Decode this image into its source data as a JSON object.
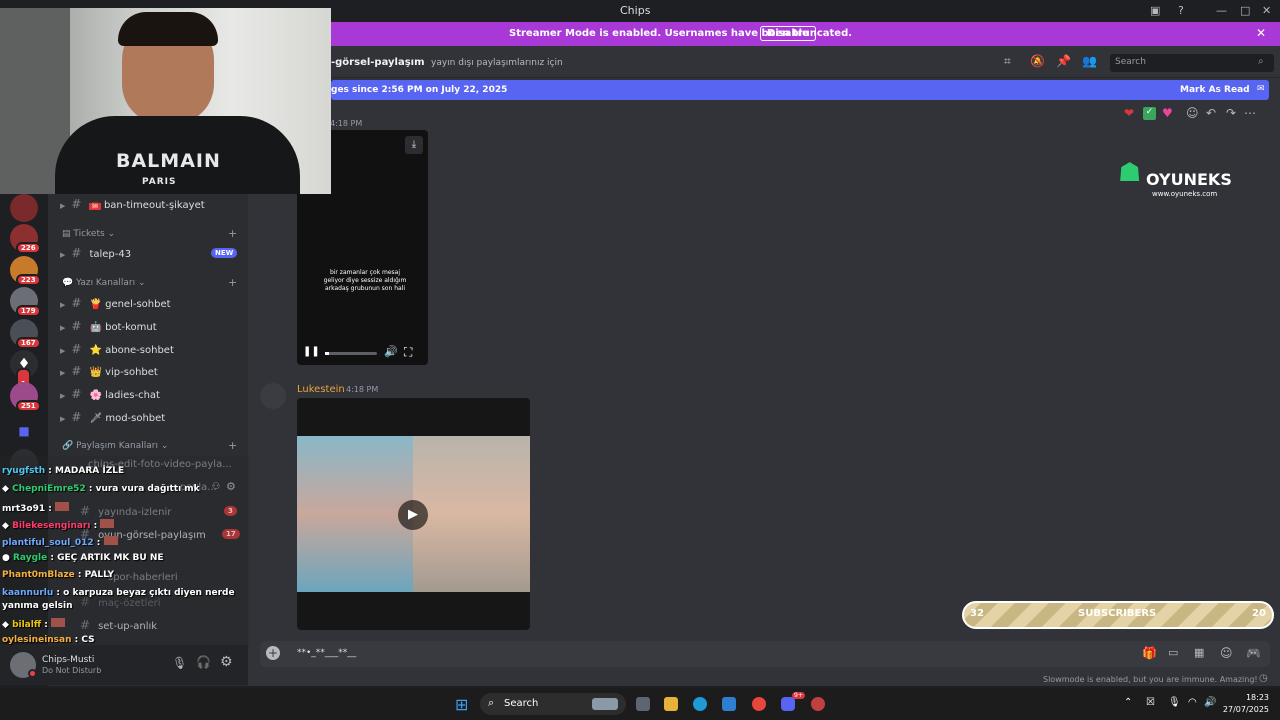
{
  "window": {
    "title": "Chips"
  },
  "banner": {
    "message": "Streamer Mode is enabled. Usernames have been truncated.",
    "disable_label": "Disable"
  },
  "header": {
    "channel": "-görsel-paylaşım",
    "topic": "yayın dışı paylaşımlarınız için",
    "search_placeholder": "Search"
  },
  "new_messages": {
    "text": "ges since 2:56 PM on July 22, 2025",
    "mark_read": "Mark As Read"
  },
  "servers": [
    {
      "count": "226"
    },
    {
      "count": "223"
    },
    {
      "count": "179"
    },
    {
      "count": "167"
    },
    {
      "count": "1"
    },
    {
      "count": "251"
    }
  ],
  "channels": {
    "ban_timeout": "ban-timeout-şikayet",
    "cat_tickets": "Tickets",
    "talep": "talep-43",
    "new_badge": "NEW",
    "cat_yazi": "Yazı Kanalları",
    "genel": "genel-sohbet",
    "bot": "bot-komut",
    "abone": "abone-sohbet",
    "vip": "vip-sohbet",
    "ladies": "ladies-chat",
    "mod": "mod-sohbet",
    "cat_paylasim": "Paylaşım Kanalları",
    "edit": "chips-edit-foto-video-payla...",
    "edit2": "payla...",
    "yayinda": "yayında-izlenir",
    "yayinda_count": "3",
    "oyun": "oyun-görsel-paylaşım",
    "oyun_count": "17",
    "spor": "spor-haberleri",
    "mac": "maç-özetleri",
    "setup": "set-up-anlık"
  },
  "user": {
    "name": "Chips-Musti",
    "status": "Do Not Disturb"
  },
  "chat_overlay": [
    {
      "user": "ryugfsth",
      "msg": "MADARA İZLE",
      "color": "#4cc9f0"
    },
    {
      "user": "ChepniEmre52",
      "msg": "vura vura dağıttı mk",
      "color": "#2ecc71"
    },
    {
      "user": "mrt3o91",
      "msg": "",
      "color": "#ffffff"
    },
    {
      "user": "Bilekesenginarı",
      "msg": "",
      "color": "#ff3b6b"
    },
    {
      "user": "plantiful_soul_012",
      "msg": "",
      "color": "#6ea8ff"
    },
    {
      "user": "Raygle",
      "msg": "GEÇ ARTIK MK BU NE",
      "color": "#2ecc71"
    },
    {
      "user": "Phant0mBlaze",
      "msg": "PALLY",
      "color": "#f5b041"
    },
    {
      "user": "kaannurlu",
      "msg": "o karpuza beyaz çıktı diyen nerde yanıma gelsin",
      "color": "#6ea8ff"
    },
    {
      "user": "bilalff",
      "msg": "",
      "color": "#f1c40f"
    },
    {
      "user": "oylesineinsan",
      "msg": "CS",
      "color": "#f5b041"
    }
  ],
  "messages": {
    "time1": "4:18 PM",
    "video1_caption": "bir zamanlar çok mesaj geliyor diye sessize aldığım arkadaş grubunun son hali",
    "author2": "Lukestein",
    "time2": "4:18 PM"
  },
  "webcam": {
    "shirt_brand": "BALMAIN",
    "shirt_sub": "PARIS"
  },
  "watermark": {
    "brand": "OYUNEKS",
    "site": "www.oyuneks.com"
  },
  "subs": {
    "left": "32",
    "label": "SUBSCRIBERS",
    "right": "20"
  },
  "input": {
    "text": "**•_**___**__"
  },
  "slowmode": "Slowmode is enabled, but you are immune. Amazing!",
  "taskbar": {
    "search": "Search",
    "time": "18:23",
    "date": "27/07/2025",
    "notif": "9+"
  }
}
